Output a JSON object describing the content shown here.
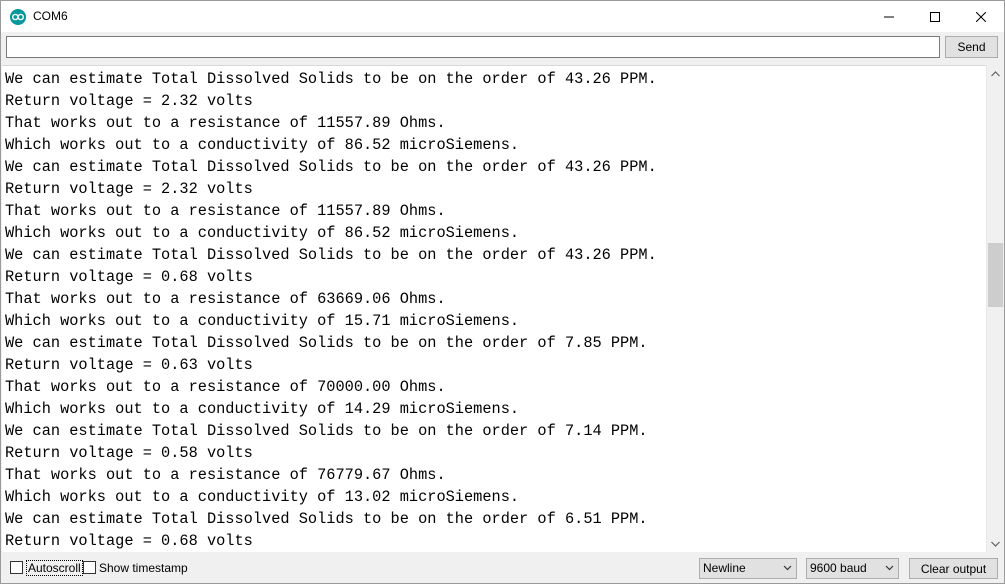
{
  "window": {
    "title": "COM6"
  },
  "input": {
    "value": "",
    "placeholder": "",
    "send_label": "Send"
  },
  "output": {
    "lines": [
      "We can estimate Total Dissolved Solids to be on the order of 43.26 PPM.",
      "Return voltage = 2.32 volts",
      "That works out to a resistance of 11557.89 Ohms.",
      "Which works out to a conductivity of 86.52 microSiemens.",
      "We can estimate Total Dissolved Solids to be on the order of 43.26 PPM.",
      "Return voltage = 2.32 volts",
      "That works out to a resistance of 11557.89 Ohms.",
      "Which works out to a conductivity of 86.52 microSiemens.",
      "We can estimate Total Dissolved Solids to be on the order of 43.26 PPM.",
      "Return voltage = 0.68 volts",
      "That works out to a resistance of 63669.06 Ohms.",
      "Which works out to a conductivity of 15.71 microSiemens.",
      "We can estimate Total Dissolved Solids to be on the order of 7.85 PPM.",
      "Return voltage = 0.63 volts",
      "That works out to a resistance of 70000.00 Ohms.",
      "Which works out to a conductivity of 14.29 microSiemens.",
      "We can estimate Total Dissolved Solids to be on the order of 7.14 PPM.",
      "Return voltage = 0.58 volts",
      "That works out to a resistance of 76779.67 Ohms.",
      "Which works out to a conductivity of 13.02 microSiemens.",
      "We can estimate Total Dissolved Solids to be on the order of 6.51 PPM.",
      "Return voltage = 0.68 volts"
    ]
  },
  "bottom": {
    "autoscroll_label": "Autoscroll",
    "autoscroll_checked": false,
    "timestamp_label": "Show timestamp",
    "timestamp_checked": false,
    "line_ending": "Newline",
    "baud": "9600 baud",
    "clear_label": "Clear output"
  },
  "colors": {
    "app_icon": "#00979d",
    "window_bg": "#f0f0f0",
    "output_bg": "#ffffff",
    "scroll_thumb": "#cdcdcd"
  }
}
